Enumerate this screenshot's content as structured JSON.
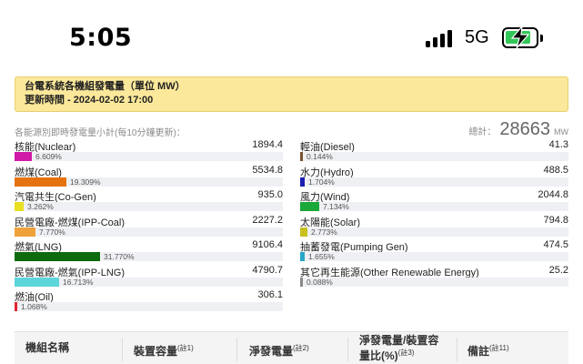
{
  "status_bar": {
    "time": "5:05",
    "network": "5G"
  },
  "header": {
    "title": "台電系統各機組發電量（單位 MW）",
    "updated": "更新時間 - 2024-02-02 17:00"
  },
  "subtitle": "各能源別即時發電量小計(每10分鐘更新)：",
  "total": {
    "label": "總計：",
    "value": "28663",
    "unit": "MW"
  },
  "left_items": [
    {
      "name": "核能(Nuclear)",
      "value": "1894.4",
      "percent": "6.609%",
      "fraction": 0.06609,
      "color": "#d11aa7"
    },
    {
      "name": "燃煤(Coal)",
      "value": "5534.8",
      "percent": "19.309%",
      "fraction": 0.19309,
      "color": "#e6720f"
    },
    {
      "name": "汽電共生(Co-Gen)",
      "value": "935.0",
      "percent": "3.262%",
      "fraction": 0.03262,
      "color": "#e8e021"
    },
    {
      "name": "民營電廠-燃煤(IPP-Coal)",
      "value": "2227.2",
      "percent": "7.770%",
      "fraction": 0.0777,
      "color": "#f0a23a"
    },
    {
      "name": "燃氣(LNG)",
      "value": "9106.4",
      "percent": "31.770%",
      "fraction": 0.3177,
      "color": "#0d6b0d"
    },
    {
      "name": "民營電廠-燃氣(IPP-LNG)",
      "value": "4790.7",
      "percent": "16.713%",
      "fraction": 0.16713,
      "color": "#5dd6da"
    },
    {
      "name": "燃油(Oil)",
      "value": "306.1",
      "percent": "1.068%",
      "fraction": 0.01068,
      "color": "#e0262e"
    }
  ],
  "right_items": [
    {
      "name": "輕油(Diesel)",
      "value": "41.3",
      "percent": "0.144%",
      "fraction": 0.00144,
      "color": "#7a5230"
    },
    {
      "name": "水力(Hydro)",
      "value": "488.5",
      "percent": "1.704%",
      "fraction": 0.01704,
      "color": "#1b1fb0"
    },
    {
      "name": "風力(Wind)",
      "value": "2044.8",
      "percent": "7.134%",
      "fraction": 0.07134,
      "color": "#1aa83a"
    },
    {
      "name": "太陽能(Solar)",
      "value": "794.8",
      "percent": "2.773%",
      "fraction": 0.02773,
      "color": "#c9c020"
    },
    {
      "name": "抽蓄發電(Pumping Gen)",
      "value": "474.5",
      "percent": "1.655%",
      "fraction": 0.01655,
      "color": "#2aa6c9"
    },
    {
      "name": "其它再生能源(Other Renewable Energy)",
      "value": "25.2",
      "percent": "0.088%",
      "fraction": 0.00088,
      "color": "#8a8a8a"
    }
  ],
  "table_header": {
    "col1": "機組名稱",
    "col2": "裝置容量",
    "col2_note": "(註1)",
    "col3": "淨發電量",
    "col3_note": "(註2)",
    "col4_line1": "淨發電量/裝置容",
    "col4_line2": "量比(%)",
    "col4_note": "(註3)",
    "col5": "備註",
    "col5_note": "(註11)"
  },
  "colors": {
    "header_bg": "#fbe89a",
    "battery": "#33c758"
  }
}
